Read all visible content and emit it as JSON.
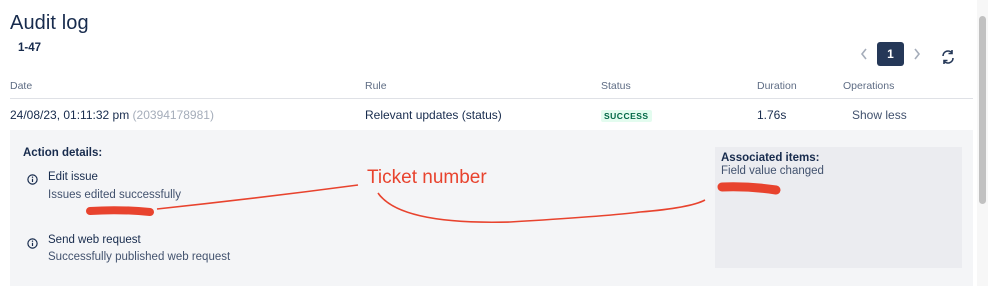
{
  "page": {
    "title": "Audit log",
    "range": "1-47"
  },
  "pagination": {
    "prev_icon": "chevron-left-icon",
    "current": "1",
    "next_icon": "chevron-right-icon",
    "refresh_icon": "refresh-icon"
  },
  "table": {
    "columns": [
      "Date",
      "Rule",
      "Status",
      "Duration",
      "Operations"
    ],
    "rows": [
      {
        "date": "24/08/23, 01:11:32 pm",
        "execution_id": "(20394178981)",
        "rule": "Relevant updates (status)",
        "status": "SUCCESS",
        "duration": "1.76s",
        "operation": "Show less"
      }
    ]
  },
  "details": {
    "title": "Action details:",
    "items": [
      {
        "title": "Edit issue",
        "subtitle": "Issues edited successfully",
        "icon": "info-icon"
      },
      {
        "title": "Send web request",
        "subtitle": "Successfully published web request",
        "icon": "info-icon"
      }
    ],
    "associated": {
      "title": "Associated items:",
      "subtitle": "Field value changed"
    }
  },
  "annotation": {
    "label": "Ticket number"
  },
  "colors": {
    "annotation": "#e8432e",
    "success_bg": "#e3fcef",
    "success_text": "#006644",
    "page_selected": "#253858"
  }
}
